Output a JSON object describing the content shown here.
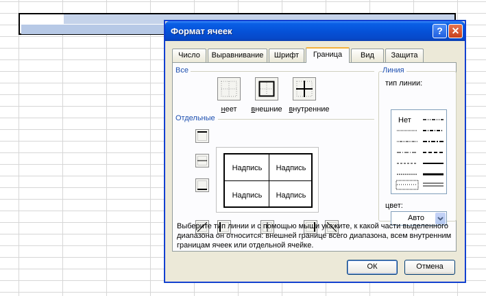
{
  "dialog": {
    "title": "Формат ячеек",
    "help_label": "?",
    "close_label": "✕"
  },
  "tabs": [
    {
      "label": "Число"
    },
    {
      "label": "Выравнивание"
    },
    {
      "label": "Шрифт"
    },
    {
      "label": "Граница",
      "active": true
    },
    {
      "label": "Вид"
    },
    {
      "label": "Защита"
    }
  ],
  "presets": {
    "group_label": "Все",
    "none_label": "нет",
    "none_hotkey": "н",
    "outline_label": "внешние",
    "outline_hotkey": "в",
    "inside_label": "нутренние",
    "inside_hotkey": "в"
  },
  "border": {
    "group_label": "Отдельные",
    "cells": [
      "Надпись",
      "Надпись",
      "Надпись",
      "Надпись"
    ]
  },
  "line": {
    "group_label": "Линия",
    "style_label": "тип линии:",
    "none_label": "Нет",
    "color_label": "цвет:",
    "color_value": "Авто"
  },
  "help_text": "Выберите тип линии и с помощью мыши укажите, к какой части выделенного диапазона он относится: внешней границе всего диапазона, всем внутренним границам ячеек или отдельной ячейке.",
  "buttons": {
    "ok": "ОК",
    "cancel": "Отмена"
  },
  "colors": {
    "title_blue": "#0552d8",
    "group_label": "#1b4eaf",
    "tab_highlight": "#f3b03a"
  }
}
